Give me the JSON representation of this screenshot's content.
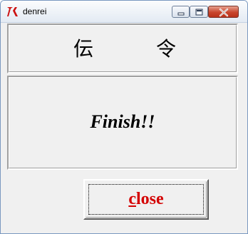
{
  "window": {
    "title": "denrei",
    "app_icon": "tk-feather-icon",
    "controls": [
      "minimize-icon",
      "maximize-icon",
      "close-icon"
    ]
  },
  "header": {
    "char1": "伝",
    "char2": "令"
  },
  "message": {
    "text": "Finish!!"
  },
  "close_button": {
    "label_underlined": "c",
    "label_rest": "lose",
    "color": "#d40000"
  },
  "colors": {
    "window_bg": "#f0f0f0",
    "titlebar_close": "#c8452c"
  }
}
